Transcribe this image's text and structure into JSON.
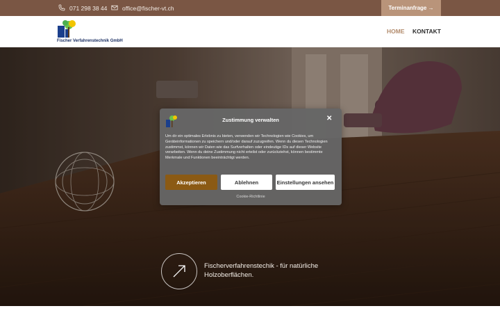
{
  "topbar": {
    "phone": "071 298 38 44",
    "email": "office@fischer-vt.ch",
    "cta_label": "Terminanfrage →",
    "phone_icon": "phone-icon",
    "email_icon": "mail-icon"
  },
  "header": {
    "logo_text": "Fischer Verfahrenstechnik GmbH",
    "nav": [
      {
        "label": "HOME",
        "active": true
      },
      {
        "label": "KONTAKT",
        "active": false
      }
    ]
  },
  "hero": {
    "text": "Fischerverfahrenstechik - für natürliche Holzoberflächen.",
    "arrow_icon": "arrow-up-right-icon"
  },
  "consent": {
    "title": "Zustimmung verwalten",
    "body": "Um dir ein optimales Erlebnis zu bieten, verwenden wir Technologien wie Cookies, um Geräteinformationen zu speichern und/oder darauf zuzugreifen. Wenn du diesen Technologien zustimmst, können wir Daten wie das Surfverhalten oder eindeutige IDs auf dieser Website verarbeiten. Wenn du deine Zustimmung nicht erteilst oder zurückziehst, können bestimmte Merkmale und Funktionen beeinträchtigt werden.",
    "accept_label": "Akzeptieren",
    "decline_label": "Ablehnen",
    "settings_label": "Einstellungen ansehen",
    "policy_label": "Cookie-Richtlinie",
    "close_icon": "close-icon"
  },
  "colors": {
    "topbar_bg": "#7a5644",
    "cta_bg": "#b9947a",
    "nav_active": "#b28b6c",
    "accept_bg": "#8b5a14",
    "modal_bg": "#666666"
  }
}
